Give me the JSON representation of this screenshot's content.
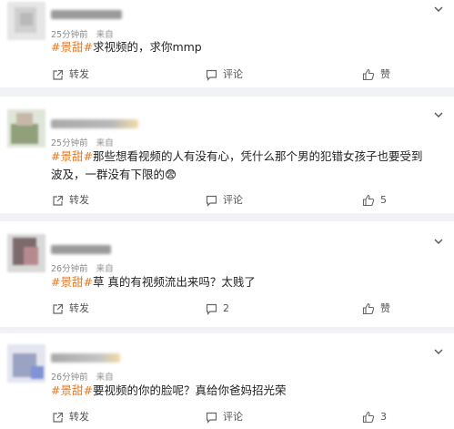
{
  "comments": [
    {
      "time": "25分钟前",
      "source": "来自",
      "hashtag": "#景甜#",
      "text": "求视频的，求你mmp",
      "emoji": "",
      "repost_label": "转发",
      "comment_label": "评论",
      "like_label": "赞"
    },
    {
      "time": "25分钟前",
      "source": "来自",
      "hashtag": "#景甜#",
      "text": "那些想看视频的人有没有心，凭什么那个男的犯错女孩子也要受到波及，一群没有下限的",
      "emoji": "😨",
      "repost_label": "转发",
      "comment_label": "评论",
      "like_label": "5"
    },
    {
      "time": "26分钟前",
      "source": "来自",
      "hashtag": "#景甜#",
      "text": "草 真的有视频流出来吗？太贱了",
      "emoji": "",
      "repost_label": "转发",
      "comment_label": "2",
      "like_label": "赞"
    },
    {
      "time": "26分钟前",
      "source": "来自",
      "hashtag": "#景甜#",
      "text": "要视频的你的脸呢？真给你爸妈招光荣",
      "emoji": "",
      "repost_label": "转发",
      "comment_label": "评论",
      "like_label": "3"
    }
  ],
  "colors": {
    "hashtag": "#e8781e",
    "background": "#f1f2f5",
    "card": "#ffffff",
    "icon": "#666666"
  },
  "icons": {
    "repost": "repost-icon",
    "comment": "comment-icon",
    "like": "thumbs-up-icon",
    "menu": "chevron-down-icon"
  }
}
